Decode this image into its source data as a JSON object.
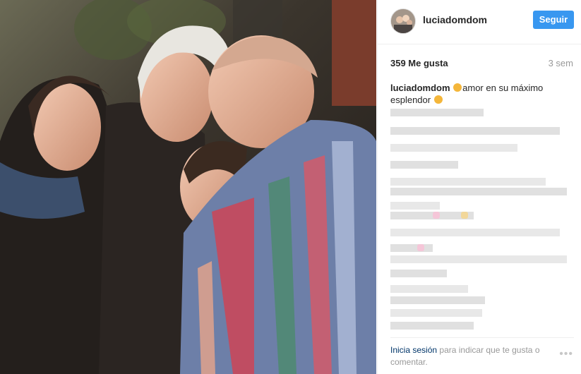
{
  "post": {
    "username": "luciadomdom",
    "follow_label": "Seguir",
    "likes": "359 Me gusta",
    "time": "3 sem",
    "caption_user": "luciadomdom",
    "caption_text": "amor en su máximo esplendor",
    "footer_login": "Inicia sesión",
    "footer_text": "para indicar que te gusta o comentar.",
    "more_label": "•••"
  },
  "colors": {
    "follow_button": "#3897f0",
    "login_link": "#003569",
    "muted_text": "#999999",
    "emoji": "#f4b63a"
  },
  "icons": {
    "emoji": "smiling-face-emoji",
    "more": "more-options-icon"
  }
}
